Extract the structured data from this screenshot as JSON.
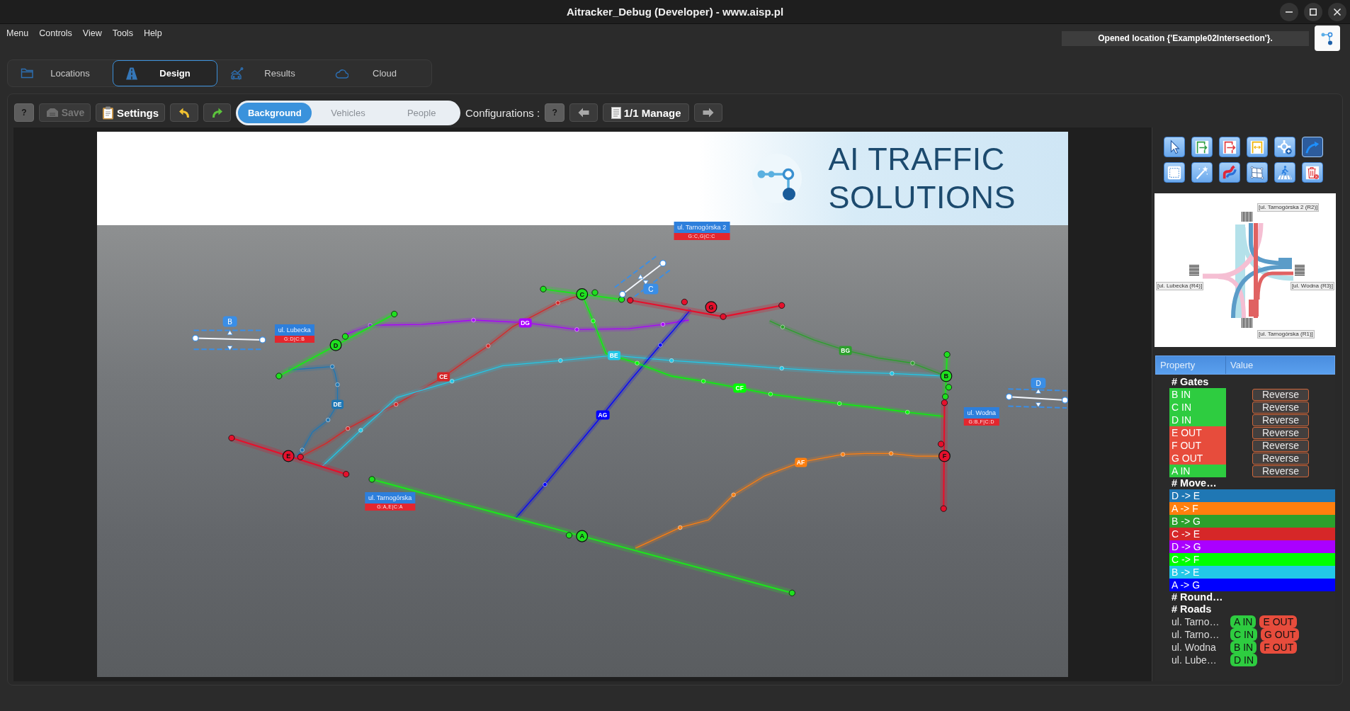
{
  "window": {
    "title": "Aitracker_Debug (Developer) - www.aisp.pl"
  },
  "menu": [
    "Menu",
    "Controls",
    "View",
    "Tools",
    "Help"
  ],
  "status": {
    "message": "Opened location {'Example02Intersection'}."
  },
  "tabs": [
    {
      "label": "Locations",
      "selected": false
    },
    {
      "label": "Design",
      "selected": true
    },
    {
      "label": "Results",
      "selected": false
    },
    {
      "label": "Cloud",
      "selected": false
    }
  ],
  "toolbar": {
    "help": "?",
    "save": {
      "label": "Save",
      "disabled": true
    },
    "settings": {
      "label": "Settings"
    },
    "view_modes": [
      {
        "label": "Background",
        "selected": true
      },
      {
        "label": "Vehicles",
        "selected": false
      },
      {
        "label": "People",
        "selected": false
      }
    ],
    "configurations": {
      "label": "Configurations :",
      "help": "?",
      "manage": "1/1 Manage"
    }
  },
  "canvas": {
    "banner": {
      "lines": [
        "AI TRAFFIC",
        "SOLUTIONS"
      ]
    },
    "roads": [
      {
        "name": "ul. Lubecka",
        "code": "G:D|C:B"
      },
      {
        "name": "ul. Tarnogórska 2",
        "code": "G:C,G|C:C"
      },
      {
        "name": "ul. Wodna",
        "code": "G:B,F|C:D"
      },
      {
        "name": "ul. Tarnogórska",
        "code": "G:A,E|C:A"
      }
    ],
    "crossings": [
      {
        "label": "B"
      },
      {
        "label": "C"
      },
      {
        "label": "D"
      }
    ],
    "gates": [
      {
        "label": "A",
        "kind": "in"
      },
      {
        "label": "B",
        "kind": "in"
      },
      {
        "label": "C",
        "kind": "in"
      },
      {
        "label": "D",
        "kind": "in"
      },
      {
        "label": "E",
        "kind": "out"
      },
      {
        "label": "F",
        "kind": "out"
      },
      {
        "label": "G",
        "kind": "out"
      }
    ],
    "movements": [
      {
        "label": "DG",
        "color": "#aa00ff"
      },
      {
        "label": "CE",
        "color": "#d62728"
      },
      {
        "label": "BE",
        "color": "#22c8e8"
      },
      {
        "label": "DE",
        "color": "#1f77b4"
      },
      {
        "label": "AG",
        "color": "#0000ff"
      },
      {
        "label": "CF",
        "color": "#00ff00"
      },
      {
        "label": "BG",
        "color": "#2ca02c"
      },
      {
        "label": "AF",
        "color": "#ff7f0e"
      }
    ]
  },
  "tools": [
    {
      "selected": false
    },
    {
      "selected": false
    },
    {
      "selected": false
    },
    {
      "selected": false
    },
    {
      "selected": false
    },
    {
      "selected": true
    },
    {
      "selected": false
    },
    {
      "selected": false
    },
    {
      "selected": false
    },
    {
      "selected": false
    },
    {
      "selected": false
    },
    {
      "selected": false
    }
  ],
  "minimap": {
    "labels": [
      "[ul. Tarnogórska 2 (R2)]",
      "[ul. Lubecka (R4)]",
      "[ul. Wodna (R3)]",
      "[ul. Tarnogórska (R1)]"
    ]
  },
  "properties": {
    "columns": [
      "Property",
      "Value"
    ],
    "gates_heading": "# Gates",
    "gates": [
      {
        "name": "B IN",
        "kind": "in",
        "action": "Reverse"
      },
      {
        "name": "C IN",
        "kind": "in",
        "action": "Reverse"
      },
      {
        "name": "D IN",
        "kind": "in",
        "action": "Reverse"
      },
      {
        "name": "E OUT",
        "kind": "out",
        "action": "Reverse"
      },
      {
        "name": "F OUT",
        "kind": "out",
        "action": "Reverse"
      },
      {
        "name": "G OUT",
        "kind": "out",
        "action": "Reverse"
      },
      {
        "name": "A IN",
        "kind": "in",
        "action": "Reverse"
      }
    ],
    "movements_heading": "# Move…",
    "movements": [
      {
        "name": "D -> E",
        "color": "#1f77b4"
      },
      {
        "name": "A -> F",
        "color": "#ff7f0e"
      },
      {
        "name": "B -> G",
        "color": "#2ca02c"
      },
      {
        "name": "C -> E",
        "color": "#d62728"
      },
      {
        "name": "D -> G",
        "color": "#aa00ff"
      },
      {
        "name": "C -> F",
        "color": "#00ff00"
      },
      {
        "name": "B -> E",
        "color": "#22c8e8"
      },
      {
        "name": "A -> G",
        "color": "#0000ff"
      }
    ],
    "roundabouts_heading": "# Round…",
    "roads_heading": "# Roads",
    "roads": [
      {
        "name": "ul. Tarno…",
        "gates": [
          {
            "label": "A IN",
            "kind": "in"
          },
          {
            "label": "E OUT",
            "kind": "out"
          }
        ]
      },
      {
        "name": "ul. Tarno…",
        "gates": [
          {
            "label": "C IN",
            "kind": "in"
          },
          {
            "label": "G OUT",
            "kind": "out"
          }
        ]
      },
      {
        "name": "ul. Wodna",
        "gates": [
          {
            "label": "B IN",
            "kind": "in"
          },
          {
            "label": "F OUT",
            "kind": "out"
          }
        ]
      },
      {
        "name": "ul. Lube…",
        "gates": [
          {
            "label": "D IN",
            "kind": "in"
          }
        ]
      }
    ]
  }
}
